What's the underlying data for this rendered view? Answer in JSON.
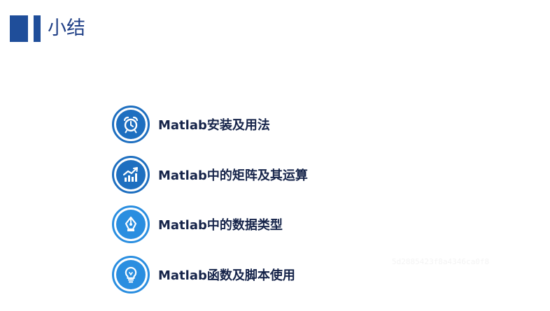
{
  "header": {
    "title": "小结"
  },
  "items": [
    {
      "label": "Matlab安装及用法",
      "icon": "alarm-clock-icon"
    },
    {
      "label": "Matlab中的矩阵及其运算",
      "icon": "growth-chart-icon"
    },
    {
      "label": "Matlab中的数据类型",
      "icon": "pen-nib-icon"
    },
    {
      "label": "Matlab函数及脚本使用",
      "icon": "light-bulb-icon"
    }
  ],
  "watermark": "5d2885423f8a4346ca0f8",
  "colors": {
    "accent": "#1f4e9a",
    "icon_ring": "#1e6fc0",
    "icon_ring_light": "#2a8ee0",
    "text": "#16244a"
  }
}
